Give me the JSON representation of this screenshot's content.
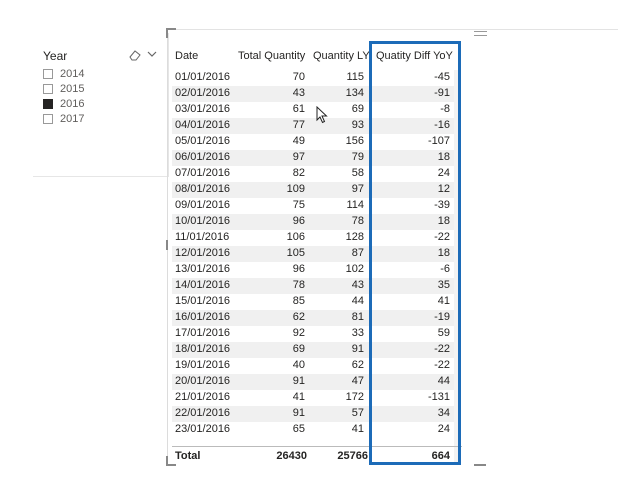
{
  "slicer": {
    "title": "Year",
    "items": [
      {
        "label": "2014",
        "checked": false
      },
      {
        "label": "2015",
        "checked": false
      },
      {
        "label": "2016",
        "checked": true
      },
      {
        "label": "2017",
        "checked": false
      }
    ],
    "icons": [
      "eraser-icon",
      "chevron-down-icon"
    ]
  },
  "table": {
    "headers": [
      "Date",
      "Total Quantity",
      "Quantity LY",
      "Quatity Diff YoY"
    ],
    "rows": [
      [
        "01/01/2016",
        "70",
        "115",
        "-45"
      ],
      [
        "02/01/2016",
        "43",
        "134",
        "-91"
      ],
      [
        "03/01/2016",
        "61",
        "69",
        "-8"
      ],
      [
        "04/01/2016",
        "77",
        "93",
        "-16"
      ],
      [
        "05/01/2016",
        "49",
        "156",
        "-107"
      ],
      [
        "06/01/2016",
        "97",
        "79",
        "18"
      ],
      [
        "07/01/2016",
        "82",
        "58",
        "24"
      ],
      [
        "08/01/2016",
        "109",
        "97",
        "12"
      ],
      [
        "09/01/2016",
        "75",
        "114",
        "-39"
      ],
      [
        "10/01/2016",
        "96",
        "78",
        "18"
      ],
      [
        "11/01/2016",
        "106",
        "128",
        "-22"
      ],
      [
        "12/01/2016",
        "105",
        "87",
        "18"
      ],
      [
        "13/01/2016",
        "96",
        "102",
        "-6"
      ],
      [
        "14/01/2016",
        "78",
        "43",
        "35"
      ],
      [
        "15/01/2016",
        "85",
        "44",
        "41"
      ],
      [
        "16/01/2016",
        "62",
        "81",
        "-19"
      ],
      [
        "17/01/2016",
        "92",
        "33",
        "59"
      ],
      [
        "18/01/2016",
        "69",
        "91",
        "-22"
      ],
      [
        "19/01/2016",
        "40",
        "62",
        "-22"
      ],
      [
        "20/01/2016",
        "91",
        "47",
        "44"
      ],
      [
        "21/01/2016",
        "41",
        "172",
        "-131"
      ],
      [
        "22/01/2016",
        "91",
        "57",
        "34"
      ],
      [
        "23/01/2016",
        "65",
        "41",
        "24"
      ]
    ],
    "totals": [
      "Total",
      "26430",
      "25766",
      "664"
    ]
  },
  "colors": {
    "highlight": "#1c6bb8",
    "row_alt": "#f0f0f0"
  }
}
